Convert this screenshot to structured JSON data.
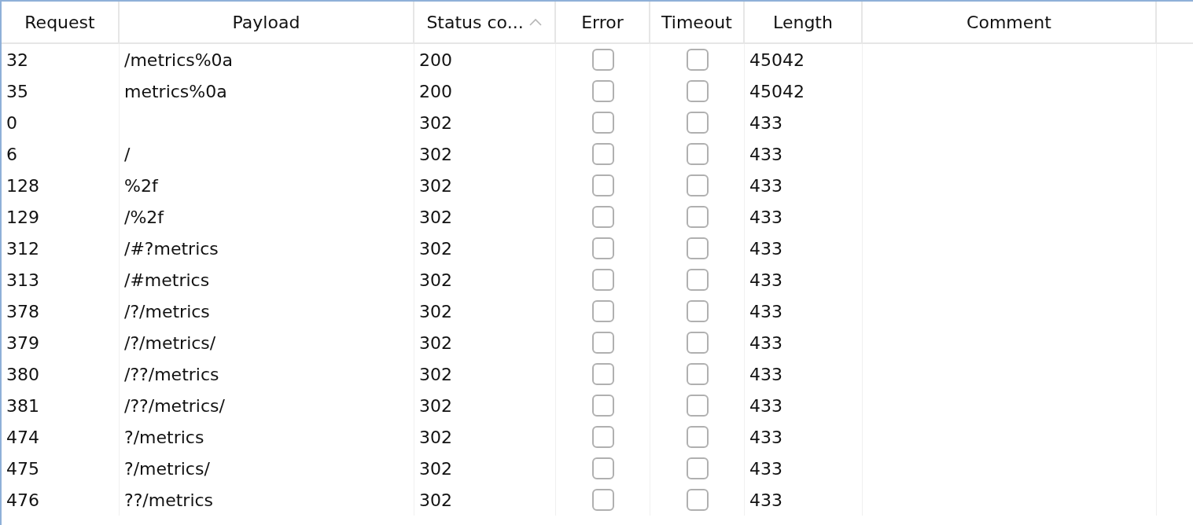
{
  "table": {
    "columns": [
      {
        "label": "Request",
        "sorted": false
      },
      {
        "label": "Payload",
        "sorted": false
      },
      {
        "label": "Status co...",
        "sorted": true
      },
      {
        "label": "Error",
        "sorted": false
      },
      {
        "label": "Timeout",
        "sorted": false
      },
      {
        "label": "Length",
        "sorted": false
      },
      {
        "label": "Comment",
        "sorted": false
      }
    ],
    "rows": [
      {
        "request": "32",
        "payload": "/metrics%0a",
        "status": "200",
        "error": false,
        "timeout": false,
        "length": "45042"
      },
      {
        "request": "35",
        "payload": "metrics%0a",
        "status": "200",
        "error": false,
        "timeout": false,
        "length": "45042"
      },
      {
        "request": "0",
        "status": "302",
        "error": false,
        "timeout": false,
        "length": "433"
      },
      {
        "request": "6",
        "payload": "/",
        "status": "302",
        "error": false,
        "timeout": false,
        "length": "433"
      },
      {
        "request": "128",
        "payload": "%2f",
        "status": "302",
        "error": false,
        "timeout": false,
        "length": "433"
      },
      {
        "request": "129",
        "payload": "/%2f",
        "status": "302",
        "error": false,
        "timeout": false,
        "length": "433"
      },
      {
        "request": "312",
        "payload": "/#?metrics",
        "status": "302",
        "error": false,
        "timeout": false,
        "length": "433"
      },
      {
        "request": "313",
        "payload": "/#metrics",
        "status": "302",
        "error": false,
        "timeout": false,
        "length": "433"
      },
      {
        "request": "378",
        "payload": "/?/metrics",
        "status": "302",
        "error": false,
        "timeout": false,
        "length": "433"
      },
      {
        "request": "379",
        "payload": "/?/metrics/",
        "status": "302",
        "error": false,
        "timeout": false,
        "length": "433"
      },
      {
        "request": "380",
        "payload": "/??/metrics",
        "status": "302",
        "error": false,
        "timeout": false,
        "length": "433"
      },
      {
        "request": "381",
        "payload": "/??/metrics/",
        "status": "302",
        "error": false,
        "timeout": false,
        "length": "433"
      },
      {
        "request": "474",
        "payload": "?/metrics",
        "status": "302",
        "error": false,
        "timeout": false,
        "length": "433"
      },
      {
        "request": "475",
        "payload": "?/metrics/",
        "status": "302",
        "error": false,
        "timeout": false,
        "length": "433"
      },
      {
        "request": "476",
        "payload": "??/metrics",
        "status": "302",
        "error": false,
        "timeout": false,
        "length": "433"
      }
    ]
  }
}
